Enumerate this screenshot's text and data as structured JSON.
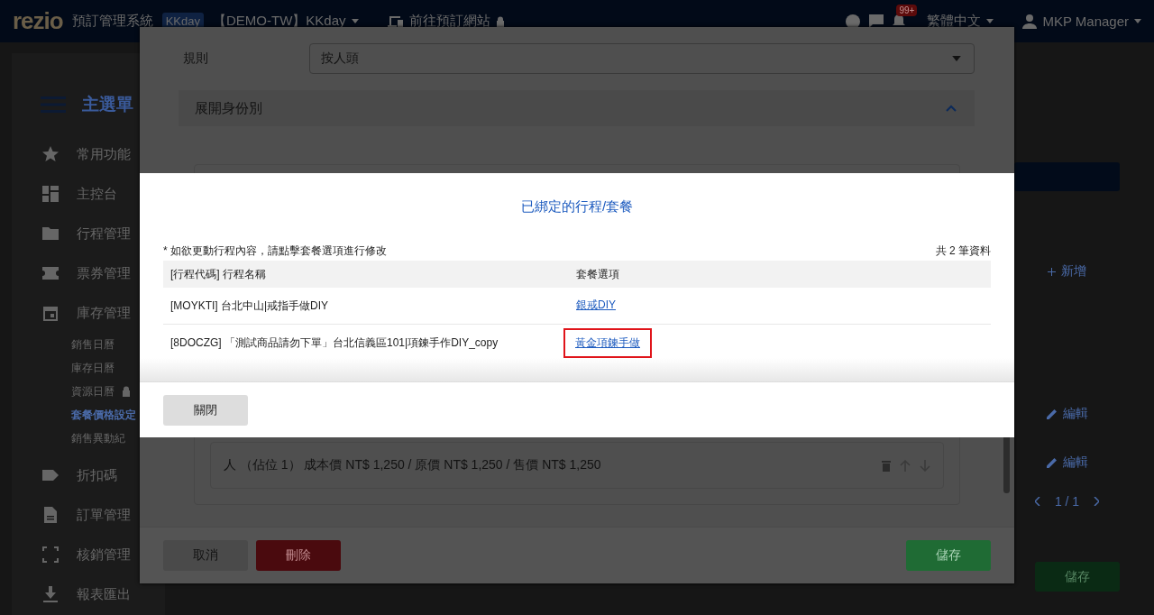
{
  "top_bar": {
    "logo": "rezio",
    "system_name": "預訂管理系統",
    "account_badge": "KKday",
    "account": "【DEMO-TW】KKday",
    "site_link": "前往預訂網站",
    "notification_count": "99+",
    "language": "繁體中文",
    "user": "MKP Manager"
  },
  "sidebar": {
    "title": "主選單",
    "items": [
      {
        "label": "常用功能",
        "selected": false
      },
      {
        "label": "主控台",
        "selected": false
      },
      {
        "label": "行程管理",
        "selected": false
      },
      {
        "label": "票券管理",
        "selected": false
      },
      {
        "label": "庫存管理",
        "selected": false,
        "children": [
          {
            "label": "銷售日曆",
            "selected": false,
            "locked": false
          },
          {
            "label": "庫存日曆",
            "selected": false,
            "locked": false
          },
          {
            "label": "資源日曆",
            "selected": false,
            "locked": true
          },
          {
            "label": "套餐價格設定",
            "selected": true,
            "locked": false
          },
          {
            "label": "銷售異動紀",
            "selected": false,
            "locked": false
          }
        ]
      },
      {
        "label": "折扣碼",
        "selected": false
      },
      {
        "label": "訂單管理",
        "selected": false
      },
      {
        "label": "核銷管理",
        "selected": false
      },
      {
        "label": "報表匯出",
        "selected": false
      }
    ]
  },
  "main": {
    "add_button": "新增",
    "edit_links": [
      "編輯",
      "編輯"
    ],
    "pagination": "1 / 1",
    "save_button": "儲存"
  },
  "edit_dialog": {
    "rule_label": "規則",
    "rule_value": "按人頭",
    "section": {
      "title": "展開身份別",
      "expanded": true
    },
    "price_row": "人 （佔位 1） 成本價 NT$ 1,250 / 原價 NT$ 1,250 / 售價 NT$ 1,250",
    "cancel_button": "取消",
    "delete_button": "刪除",
    "save_button": "儲存"
  },
  "bound_dialog": {
    "title": "已綁定的行程/套餐",
    "note": "* 如欲更動行程內容，請點擊套餐選項進行修改",
    "count": "共 2 筆資料",
    "columns": [
      "[行程代碼] 行程名稱",
      "套餐選項"
    ],
    "rows": [
      {
        "product": "[MOYKTI] 台北中山|戒指手做DIY",
        "package": "銀戒DIY",
        "highlighted": false
      },
      {
        "product": "[8DOCZG] 「測試商品請勿下單」台北信義區101|項鍊手作DIY_copy",
        "package": "黃金項鍊手做",
        "highlighted": true
      }
    ],
    "close_button": "關閉"
  }
}
